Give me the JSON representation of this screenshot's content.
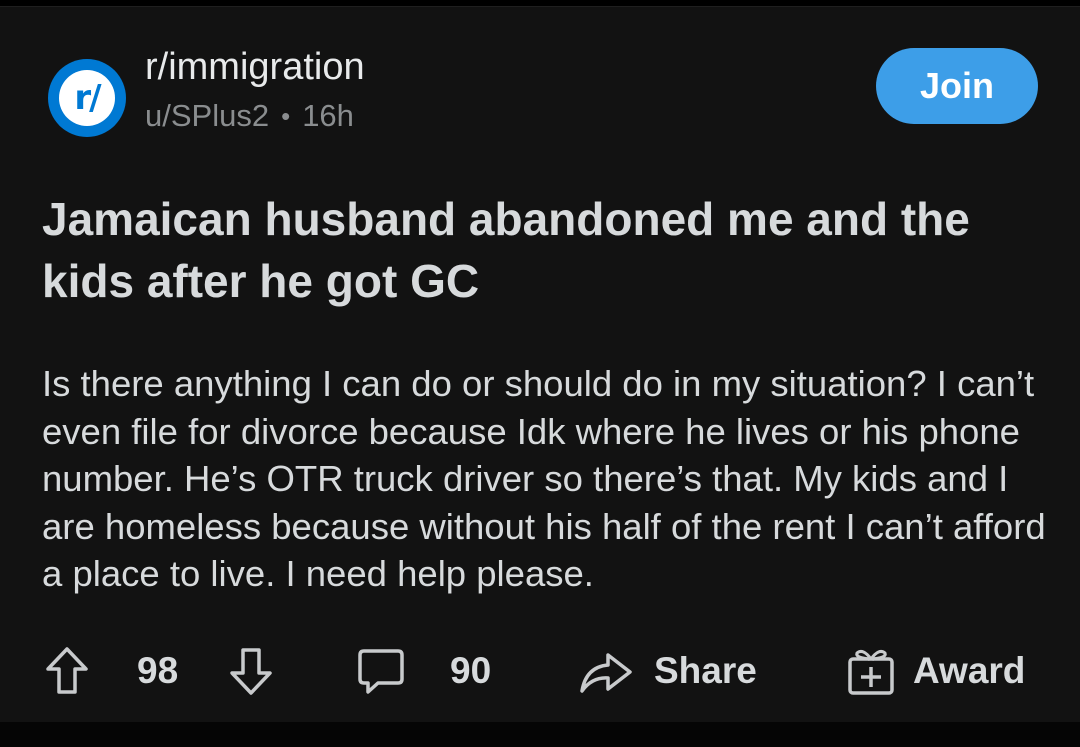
{
  "post": {
    "subreddit": "r/immigration",
    "subreddit_icon_text": "r/",
    "author": "u/SPlus2",
    "separator": "•",
    "age": "16h",
    "join_label": "Join",
    "title": "Jamaican husband abandoned me and the kids after he got GC",
    "body": "Is there anything I can do or should do in my situation? I can’t even file for divorce because Idk where he lives or his phone number. He’s OTR truck driver so there’s that. My kids and I are homeless because without his half of the rent I can’t afford a place to live. I need help please."
  },
  "actions": {
    "score": "98",
    "comment_count": "90",
    "share_label": "Share",
    "award_label": "Award"
  },
  "icons": {
    "upvote": "upvote-arrow-icon",
    "downvote": "downvote-arrow-icon",
    "comments": "comment-bubble-icon",
    "share": "share-arrow-icon",
    "award": "gift-award-icon"
  },
  "colors": {
    "background": "#121212",
    "join_button": "#3d9ee8",
    "subreddit_icon": "#0079d3",
    "text_primary": "#d7dadc",
    "text_meta": "#8a8d8f"
  }
}
